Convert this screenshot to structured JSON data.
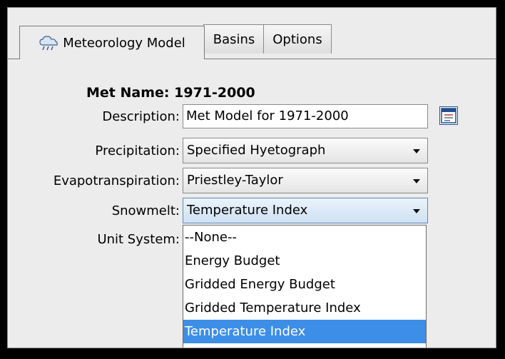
{
  "tabs": [
    {
      "label": "Meteorology Model",
      "icon": "weather-cloud-icon",
      "active": true
    },
    {
      "label": "Basins",
      "active": false
    },
    {
      "label": "Options",
      "active": false
    }
  ],
  "met_name": {
    "label": "Met Name:",
    "value": "1971-2000"
  },
  "description": {
    "label": "Description:",
    "value": "Met Model for 1971-2000",
    "button_icon": "description-editor-icon"
  },
  "precipitation": {
    "label": "Precipitation:",
    "value": "Specified Hyetograph"
  },
  "evapotranspiration": {
    "label": "Evapotranspiration:",
    "value": "Priestley-Taylor"
  },
  "snowmelt": {
    "label": "Snowmelt:",
    "value": "Temperature Index",
    "options": [
      "--None--",
      "Energy Budget",
      "Gridded Energy Budget",
      "Gridded Temperature Index",
      "Temperature Index"
    ],
    "highlighted": "Temperature Index"
  },
  "unit_system": {
    "label": "Unit System:"
  },
  "colors": {
    "selection": "#3d8ee6",
    "panel": "#ececec",
    "frame": "#000000"
  }
}
